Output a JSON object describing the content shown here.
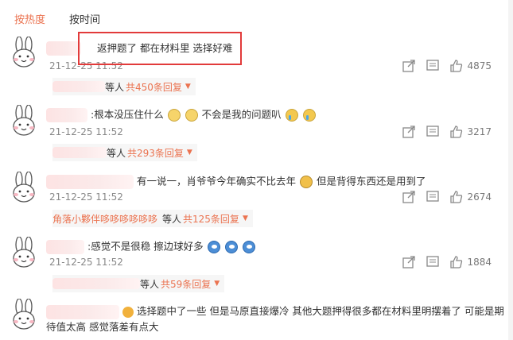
{
  "tabs": {
    "hot": "按热度",
    "time": "按时间"
  },
  "colors": {
    "accent": "#eb7350",
    "highlight_border": "#e23a3a"
  },
  "comments": [
    {
      "text": "返押题了 都在材料里 选择好难",
      "time": "21-12-25 11:52",
      "likes": "4875",
      "reply_who": "等人",
      "reply_count": "共450条回复"
    },
    {
      "text_a": ":根本没压住什么",
      "text_b": "不会是我的问题叭",
      "time": "21-12-25 11:52",
      "likes": "3217",
      "reply_who": "等人",
      "reply_count": "共293条回复"
    },
    {
      "text_a": "有一说一，肖爷爷今年确实不比去年",
      "text_b": "但是背得东西还是用到了",
      "time": "21-12-25 11:52",
      "likes": "2674",
      "reply_name": "角落小夥伴哆哆哆哆哆哆",
      "reply_who": "等人",
      "reply_count": "共125条回复"
    },
    {
      "text": ":感觉不是很稳  擦边球好多",
      "time": "21-12-25 11:52",
      "likes": "1884",
      "reply_who": "等人",
      "reply_count": "共59条回复"
    },
    {
      "text_line1": "选择题中了一些 但是马原直接爆冷 其他大题押得很多都在材料里明摆着了 可能是期",
      "text_line2": "待值太高 感觉落差有点大"
    }
  ],
  "icons": {
    "share": "share-icon",
    "comment": "comment-icon",
    "like": "thumb-up-icon",
    "expand": "triangle-down-icon"
  }
}
